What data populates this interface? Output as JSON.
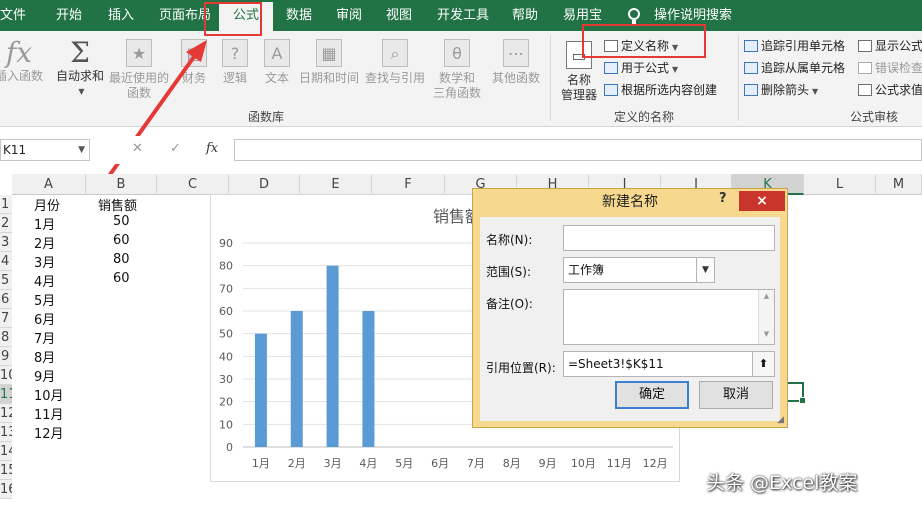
{
  "tabs": [
    "文件",
    "开始",
    "插入",
    "页面布局",
    "公式",
    "数据",
    "审阅",
    "视图",
    "开发工具",
    "帮助",
    "易用宝",
    "操作说明搜索"
  ],
  "ribbon": {
    "insert_function": "插入函数",
    "autosum": "自动求和",
    "recent": "最近使用的",
    "recent2": "函数",
    "finance": "财务",
    "logic": "逻辑",
    "text": "文本",
    "datetime": "日期和时间",
    "lookup": "查找与引用",
    "math": "数学和",
    "math2": "三角函数",
    "other": "其他函数",
    "group_library": "函数库",
    "name_manager": "名称",
    "name_manager2": "管理器",
    "define_name": "定义名称",
    "use_in_formula": "用于公式",
    "create_from_selection": "根据所选内容创建",
    "group_names": "定义的名称",
    "trace_precedents": "追踪引用单元格",
    "trace_dependents": "追踪从属单元格",
    "remove_arrows": "删除箭头",
    "show_formulas": "显示公式",
    "error_check": "错误检查",
    "evaluate": "公式求值",
    "group_audit": "公式审核"
  },
  "formula_bar": {
    "name_box": "K11",
    "fx": "fx"
  },
  "columns": [
    "A",
    "B",
    "C",
    "D",
    "E",
    "F",
    "G",
    "H",
    "I",
    "J",
    "K",
    "L",
    "M"
  ],
  "rows": [
    "1",
    "2",
    "3",
    "4",
    "5",
    "6",
    "7",
    "8",
    "9",
    "10",
    "11",
    "12",
    "13",
    "14",
    "15",
    "16"
  ],
  "sheet": {
    "header_month": "月份",
    "header_sales": "销售额",
    "months": [
      "1月",
      "2月",
      "3月",
      "4月",
      "5月",
      "6月",
      "7月",
      "8月",
      "9月",
      "10月",
      "11月",
      "12月"
    ],
    "sales": [
      "50",
      "60",
      "80",
      "60"
    ]
  },
  "chart_data": {
    "type": "bar",
    "title": "销售额",
    "categories": [
      "1月",
      "2月",
      "3月",
      "4月",
      "5月",
      "6月",
      "7月",
      "8月",
      "9月",
      "10月",
      "11月",
      "12月"
    ],
    "values": [
      50,
      60,
      80,
      60,
      null,
      null,
      null,
      null,
      null,
      null,
      null,
      null
    ],
    "ylim": [
      0,
      90
    ],
    "yticks": [
      "0",
      "10",
      "20",
      "30",
      "40",
      "50",
      "60",
      "70",
      "80",
      "90"
    ],
    "grid": true,
    "bar_color": "#5b9bd5"
  },
  "dialog": {
    "title": "新建名称",
    "help": "?",
    "close": "×",
    "name_label": "名称(N):",
    "name_value": "",
    "scope_label": "范围(S):",
    "scope_value": "工作簿",
    "comment_label": "备注(O):",
    "ref_label": "引用位置(R):",
    "ref_value": "=Sheet3!$K$11",
    "ok": "确定",
    "cancel": "取消"
  },
  "watermark": "头条 @Excel教案",
  "colors": {
    "excel_green": "#217346",
    "annotation_red": "#e53935",
    "dialog_frame": "#f6d98f"
  }
}
